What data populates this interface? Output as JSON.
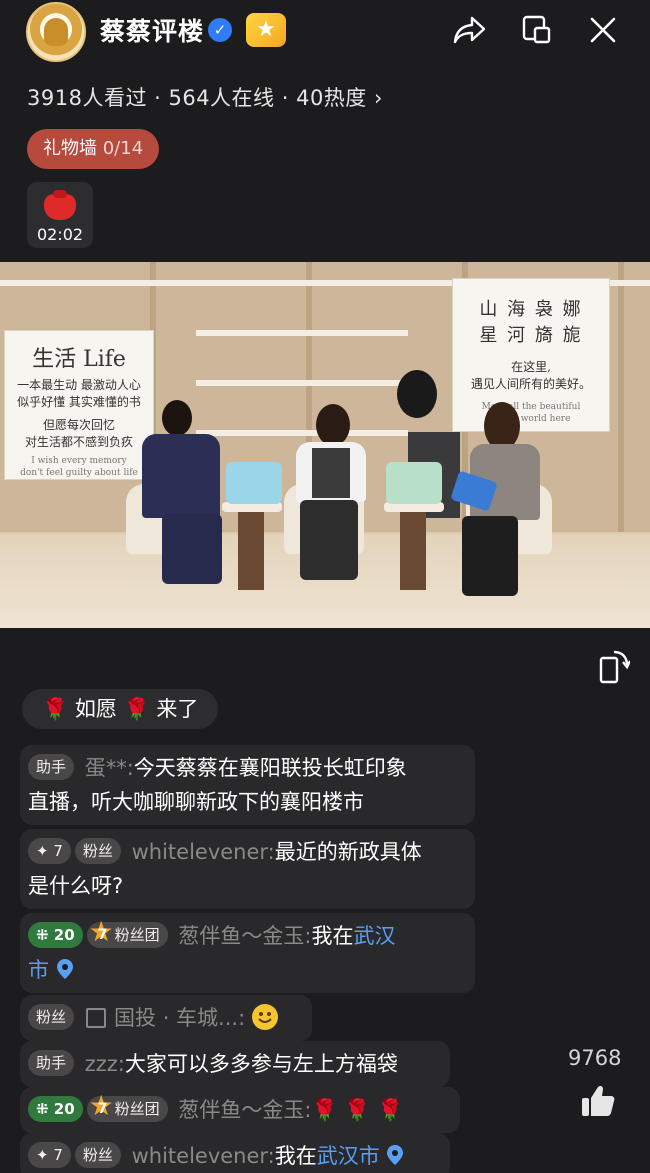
{
  "header": {
    "title": "蔡蔡评楼",
    "verified_mark": "✓",
    "star_badge": "★"
  },
  "stats": {
    "text": "3918人看过 · 564人在线 · 40热度 ›"
  },
  "gift_wall": {
    "label": "礼物墙",
    "count": "0/14"
  },
  "lucky_bag": {
    "time": "02:02"
  },
  "video": {
    "board_left": {
      "title": "生活 Life",
      "line1": "一本最生动 最激动人心",
      "line2": "似乎好懂 其实难懂的书",
      "line3": "但愿每次回忆",
      "line4": "对生活都不感到负疚",
      "line5": "I wish every memory",
      "line6": "don't feel guilty about life"
    },
    "board_right": {
      "title1": "山 海 袅 娜",
      "title2": "星 河 旖 旎",
      "line1": "在这里,",
      "line2": "遇见人间所有的美好。",
      "line3": "Meet all the beautiful",
      "line4": "in the world here"
    }
  },
  "join": {
    "rose1": "🌹",
    "name": "如愿",
    "rose2": "🌹",
    "action": "来了"
  },
  "messages": [
    {
      "tag": "助手",
      "user": "蛋**:",
      "text1": "今天蔡蔡在襄阳联投长虹印象",
      "text2": "直播，听大咖聊聊新政下的襄阳楼市"
    },
    {
      "tag1": "✦ 7",
      "tag2": "粉丝",
      "user": "whitelevener:",
      "text1": "最近的新政具体",
      "text2": "是什么呀?"
    },
    {
      "tag1": "⁜ 20",
      "fan_level": "7",
      "tag2": "粉丝团",
      "user": "葱伴鱼～金玉:",
      "text_pre": "我在",
      "hl": "武汉",
      "text2": "市"
    },
    {
      "tag": "粉丝",
      "user": "国投 · 车城...:"
    },
    {
      "tag": "助手",
      "user": "zzz:",
      "text": "大家可以多多参与左上方福袋"
    },
    {
      "tag1": "⁜ 20",
      "fan_level": "7",
      "tag2": "粉丝团",
      "user": "葱伴鱼～金玉:",
      "roses": "🌹 🌹 🌹"
    },
    {
      "tag1": "✦ 7",
      "tag2": "粉丝",
      "user": "whitelevener:",
      "text_pre": "我在",
      "hl": "武汉市"
    }
  ],
  "likes": {
    "count": "9768"
  }
}
